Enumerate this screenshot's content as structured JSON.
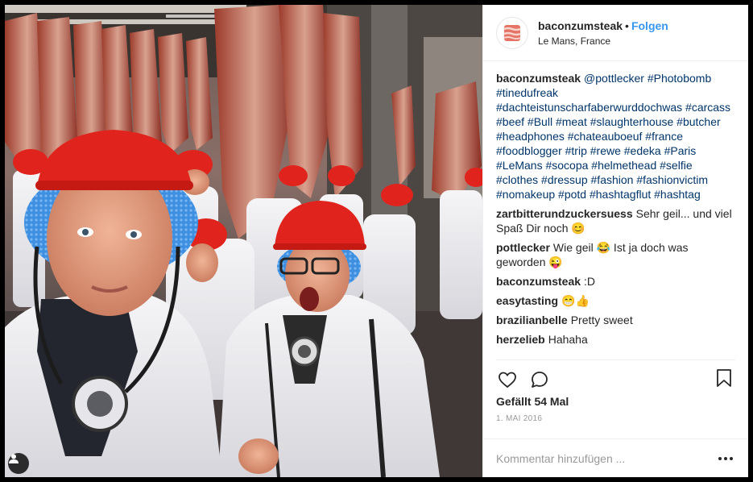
{
  "post": {
    "username": "baconzumsteak",
    "separator": "•",
    "follow_label": "Folgen",
    "location": "Le Mans, France"
  },
  "caption": {
    "author": "baconzumsteak",
    "text": "@pottlecker #Photobomb #tinedufreak #dachteistunscharfaberwurddochwas #carcass #beef #Bull #meat #slaughterhouse #butcher #headphones #chateauboeuf #france #foodblogger #trip #rewe #edeka #Paris #LeMans #socopa #helmethead #selfie #clothes #dressup #fashion #fashionvictim #nomakeup #potd #hashtagflut #hashtag"
  },
  "comments": [
    {
      "author": "zartbitterundzuckersuess",
      "text": "Sehr geil... und viel Spaß Dir noch 😊"
    },
    {
      "author": "pottlecker",
      "text": "Wie geil 😂 Ist ja doch was geworden 😜"
    },
    {
      "author": "baconzumsteak",
      "text": ":D"
    },
    {
      "author": "easytasting",
      "text": "😁👍"
    },
    {
      "author": "brazilianbelle",
      "text": "Pretty sweet"
    },
    {
      "author": "herzelieb",
      "text": "Hahaha"
    }
  ],
  "likes": "Gefällt 54 Mal",
  "date": "1. MAI 2016",
  "comment_input": {
    "placeholder": "Kommentar hinzufügen ..."
  },
  "icons": {
    "like": "heart-icon",
    "comment": "speech-bubble-icon",
    "save": "bookmark-icon",
    "more": "ellipsis-icon",
    "tagged": "user-tag-icon"
  },
  "colors": {
    "link": "#003569",
    "follow": "#3897f0",
    "helmet": "#e0231c",
    "hairnet": "#3f8fe0"
  }
}
